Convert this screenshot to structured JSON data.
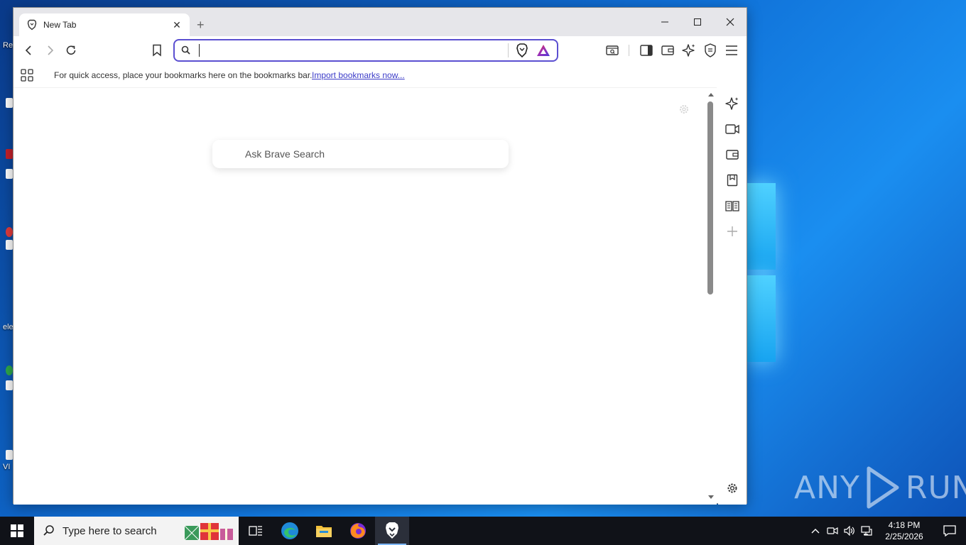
{
  "browser": {
    "tab": {
      "title": "New Tab",
      "favicon": "brave-lion-icon",
      "close_glyph": "✕"
    },
    "new_tab_glyph": "+",
    "window_controls": [
      "minimize",
      "maximize",
      "close"
    ],
    "toolbar": {
      "omnibox": {
        "value": "",
        "placeholder": ""
      },
      "accent_color": "#5b4fd1"
    },
    "bookmarks_bar": {
      "hint": "For quick access, place your bookmarks here on the bookmarks bar.",
      "import_link": "Import bookmarks now..."
    },
    "content": {
      "ask_placeholder": "Ask Brave Search"
    },
    "sidepanel_icons": [
      "leo-ai-icon",
      "video-call-icon",
      "wallet-icon",
      "bookmarks-icon",
      "reading-list-icon",
      "add-icon",
      "settings-icon"
    ]
  },
  "taskbar": {
    "search_placeholder": "Type here to search",
    "clock_time": "4:18 PM",
    "clock_date": "2/25/2026",
    "apps": [
      "task-view-icon",
      "edge-icon",
      "file-explorer-icon",
      "firefox-icon",
      "brave-icon"
    ]
  },
  "watermark": {
    "text_left": "ANY",
    "text_right": "RUN"
  }
}
